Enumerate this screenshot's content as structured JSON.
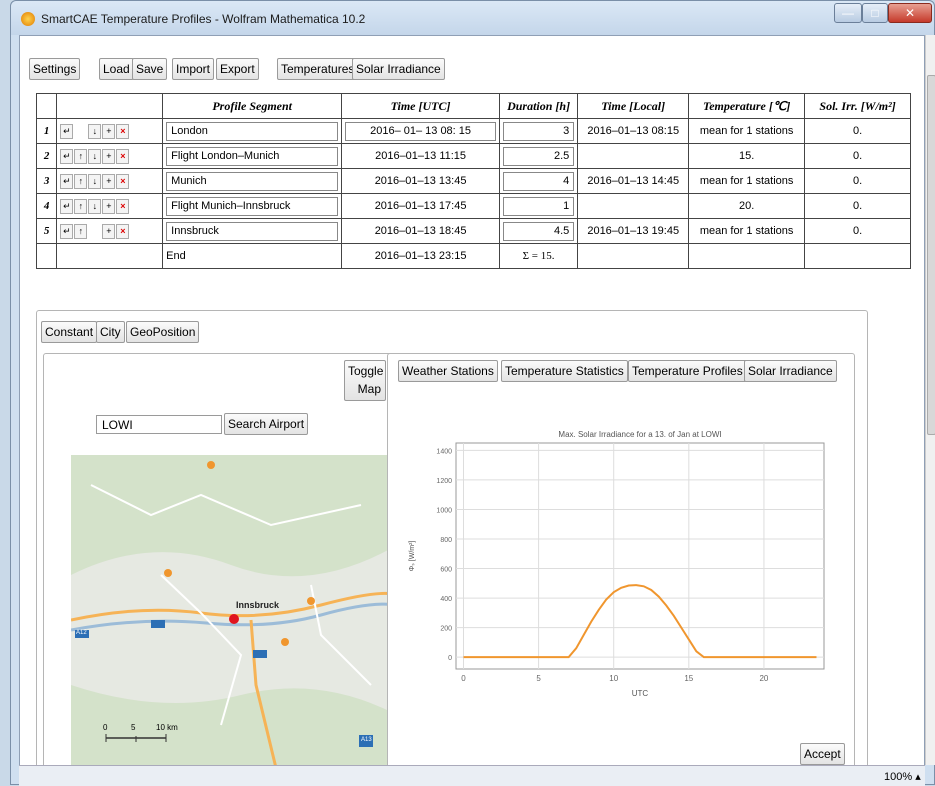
{
  "window": {
    "title": "SmartCAE Temperature Profiles - Wolfram Mathematica 10.2",
    "min": "—",
    "max": "□",
    "close": "✕"
  },
  "toolbar": {
    "settings": "Settings",
    "load": "Load",
    "save": "Save",
    "import": "Import",
    "export": "Export",
    "temperatures": "Temperatures",
    "solar": "Solar Irradiance"
  },
  "table": {
    "headers": [
      "Profile Segment",
      "Time [UTC]",
      "Duration [h]",
      "Time [Local]",
      "Temperature [℃]",
      "Sol. Irr. [W/m²]"
    ],
    "rows": [
      {
        "num": "1",
        "name": "London",
        "time_utc": "2016– 01– 13  08: 15",
        "duration": "3",
        "time_local": "2016–01–13 08:15",
        "temperature": "mean for 1 stations",
        "sol": "0."
      },
      {
        "num": "2",
        "name": "Flight London–Munich",
        "time_utc": "2016–01–13 11:15",
        "duration": "2.5",
        "time_local": "",
        "temperature": "15.",
        "sol": "0."
      },
      {
        "num": "3",
        "name": "Munich",
        "time_utc": "2016–01–13 13:45",
        "duration": "4",
        "time_local": "2016–01–13 14:45",
        "temperature": "mean for 1 stations",
        "sol": "0."
      },
      {
        "num": "4",
        "name": "Flight Munich–Innsbruck",
        "time_utc": "2016–01–13 17:45",
        "duration": "1",
        "time_local": "",
        "temperature": "20.",
        "sol": "0."
      },
      {
        "num": "5",
        "name": "Innsbruck",
        "time_utc": "2016–01–13 18:45",
        "duration": "4.5",
        "time_local": "2016–01–13 19:45",
        "temperature": "mean for 1 stations",
        "sol": "0."
      }
    ],
    "end_label": "End",
    "end_time": "2016–01–13 23:15",
    "sum": "Σ = 15."
  },
  "location_tabs": {
    "constant": "Constant",
    "city": "City",
    "geo": "GeoPosition"
  },
  "search": {
    "value": "LOWI",
    "button": "Search Airport",
    "toggle1": "Toggle",
    "toggle2": "Map"
  },
  "map": {
    "label": "Innsbruck",
    "scale_0": "0",
    "scale_5": "5",
    "scale_10": "10 km",
    "road_a12": "A12",
    "road_a13": "A13"
  },
  "chart_tabs": {
    "stations": "Weather Stations",
    "stats": "Temperature Statistics",
    "profiles": "Temperature Profiles",
    "solar": "Solar Irradiance"
  },
  "accept": "Accept",
  "zoom": "100% ▴",
  "chart_data": {
    "type": "line",
    "title": "Max. Solar Irradiance for a 13. of Jan at LOWI",
    "xlabel": "UTC",
    "ylabel": "Φₛ [W/m²]",
    "xlim": [
      -0.5,
      24
    ],
    "ylim": [
      -80,
      1450
    ],
    "xticks": [
      0,
      5,
      10,
      15,
      20
    ],
    "yticks": [
      0,
      200,
      400,
      600,
      800,
      1000,
      1200,
      1400
    ],
    "series": [
      {
        "color": "#f0962e",
        "x": [
          0,
          7,
          7.5,
          8,
          8.5,
          9,
          9.5,
          10,
          10.5,
          11,
          11.5,
          12,
          12.5,
          13,
          13.5,
          14,
          14.5,
          15,
          15.5,
          16,
          23.5
        ],
        "y": [
          0,
          0,
          60,
          150,
          240,
          320,
          390,
          440,
          470,
          485,
          488,
          480,
          455,
          410,
          350,
          280,
          200,
          120,
          40,
          0,
          0
        ]
      }
    ],
    "grid": true
  }
}
